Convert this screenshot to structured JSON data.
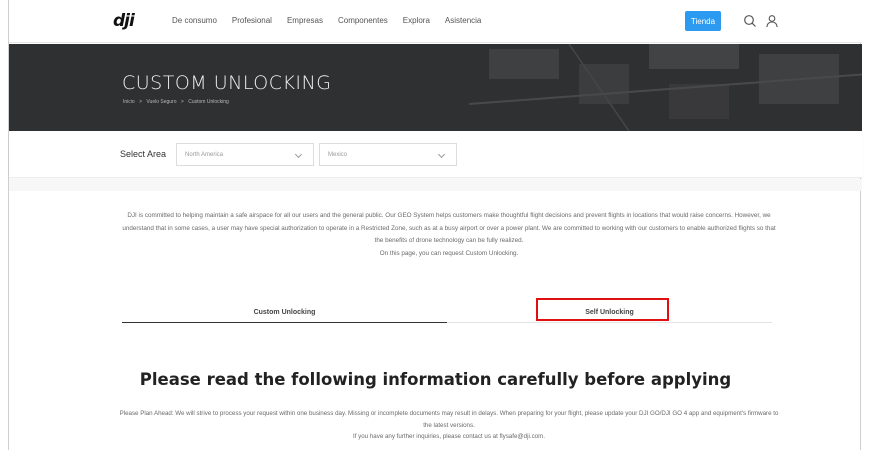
{
  "header": {
    "logo_text": "dji",
    "nav": [
      "De consumo",
      "Profesional",
      "Empresas",
      "Componentes",
      "Explora",
      "Asistencia"
    ],
    "store_label": "Tienda",
    "icons": [
      "search-icon",
      "user-icon"
    ]
  },
  "hero": {
    "title": "CUSTOM UNLOCKING",
    "breadcrumb": [
      "Inicio",
      ">",
      "Vuelo Seguro",
      ">",
      "Custom Unlocking"
    ]
  },
  "select_area": {
    "label": "Select Area",
    "region": "North America",
    "country": "Mexico"
  },
  "intro": {
    "paragraph": "DJI is committed to helping maintain a safe airspace for all our users and the general public. Our GEO System helps customers make thoughtful flight decisions and prevent flights in locations that would raise concerns. However, we understand that in some cases, a user may have special authorization to operate in a Restricted Zone, such as at a busy airport or over a power plant. We are committed to working with our customers to enable authorized flights so that the benefits of drone technology can be fully realized.",
    "line": "On this page, you can request Custom Unlocking."
  },
  "tabs": {
    "custom": "Custom Unlocking",
    "self": "Self Unlocking"
  },
  "main": {
    "heading": "Please read the following information carefully before applying",
    "notice_1": "Please Plan Ahead: We will strive to process your request within one business day. Missing or incomplete documents may result in delays. When preparing for your flight, please update your DJI GO/DJI GO 4 app and equipment's firmware to the latest versions.",
    "notice_2": "If you have any further inquiries,   please contact us at flysafe@dji.com."
  },
  "colors": {
    "accent": "#2c9af0",
    "hero_bg": "#2f3032",
    "highlight": "#e01010"
  }
}
